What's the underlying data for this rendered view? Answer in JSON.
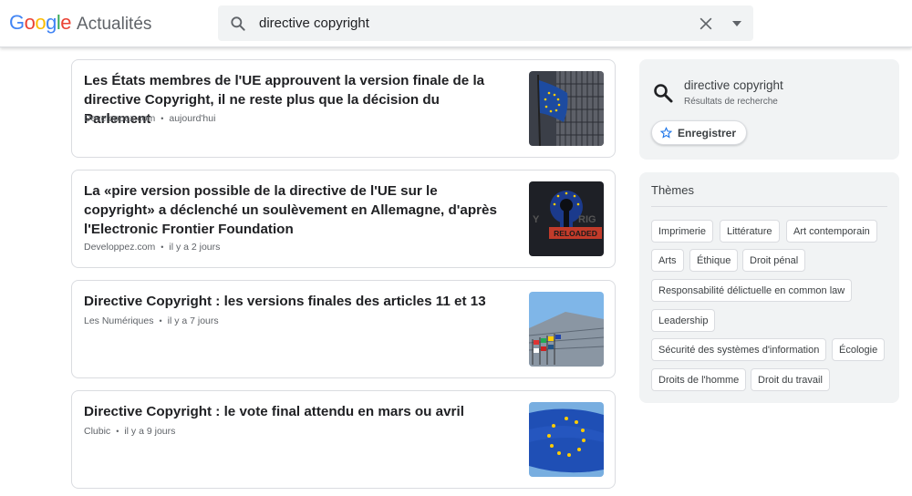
{
  "header": {
    "logo_letters": [
      "G",
      "o",
      "o",
      "g",
      "l",
      "e"
    ],
    "product": "Actualités",
    "search": {
      "value": "directive copyright",
      "icon": "search-icon",
      "clear_icon": "close-icon",
      "menu_icon": "caret-down-icon"
    }
  },
  "articles": [
    {
      "title": "Les États membres de l'UE approuvent la version finale de la directive Copyright, il ne reste plus que la décision du Parlement",
      "source": "Developpez.com",
      "time": "aujourd'hui"
    },
    {
      "title": "La «pire version possible de la directive de l'UE sur le copyright» a déclenché un soulèvement en Allemagne, d'après l'Electronic Frontier Foundation",
      "source": "Developpez.com",
      "time": "il y a 2 jours",
      "thumb_text": "RELOADED",
      "thumb_side_text": [
        "Y",
        "RIG"
      ]
    },
    {
      "title": "Directive Copyright : les versions finales des articles 11 et 13",
      "source": "Les Numériques",
      "time": "il y a 7 jours"
    },
    {
      "title": "Directive Copyright : le vote final attendu en mars ou avril",
      "source": "Clubic",
      "time": "il y a 9 jours"
    }
  ],
  "query_panel": {
    "title": "directive copyright",
    "subtitle": "Résultats de recherche",
    "save_label": "Enregistrer",
    "save_icon": "star-outline-icon"
  },
  "themes": {
    "title": "Thèmes",
    "chips": [
      "Imprimerie",
      "Littérature",
      "Art contemporain",
      "Arts",
      "Éthique",
      "Droit pénal",
      "Responsabilité délictuelle en common law",
      "Leadership",
      "Sécurité des systèmes d'information",
      "Écologie",
      "Droits de l'homme",
      "Droit du travail"
    ]
  },
  "colors": {
    "google_blue": "#4285f4",
    "google_red": "#ea4335",
    "google_yellow": "#fbbc05",
    "google_green": "#34a853",
    "panel_bg": "#f1f3f4",
    "border": "#dadce0",
    "eu_blue": "#1d4ba0",
    "eu_star": "#ffcc00"
  }
}
